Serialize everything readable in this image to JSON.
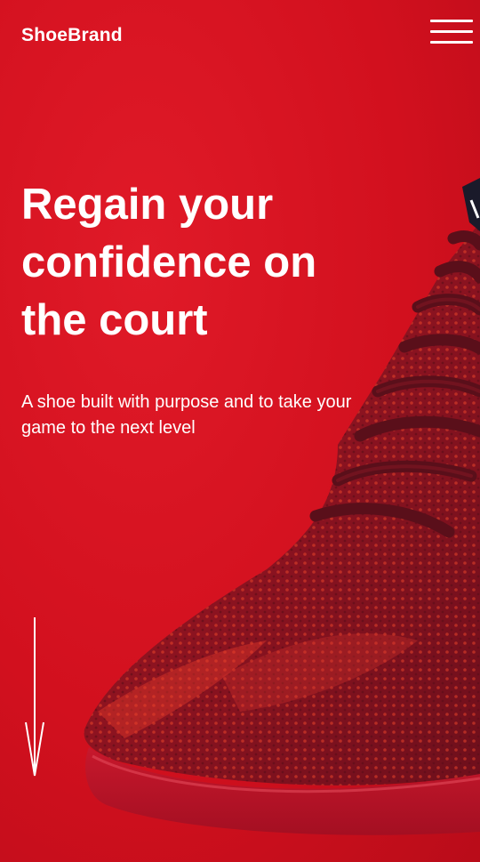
{
  "header": {
    "brand": "ShoeBrand",
    "menu_icon": "hamburger-menu-icon"
  },
  "hero": {
    "headline_lines": [
      "Regain your",
      "confidence on",
      "the court"
    ],
    "subtitle_lines": [
      "A shoe built with purpose and to take your",
      "game to the next level"
    ],
    "scroll_icon": "arrow-down-icon",
    "image": "red-knit-sneaker-photo"
  },
  "colors": {
    "background": "#d2101e",
    "text": "#ffffff",
    "shoe_knit": "#8e1420",
    "shoe_laces": "#5a0f1a",
    "sole": "#c0152a"
  }
}
